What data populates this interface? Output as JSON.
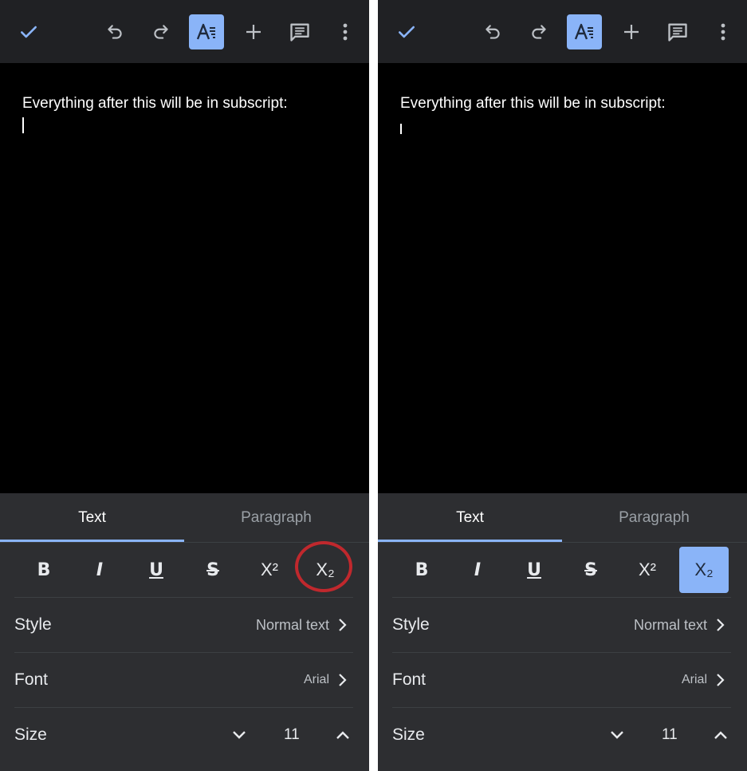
{
  "panels": [
    {
      "id": "before",
      "doc_text": "Everything after this will be in subscript:",
      "tabs": {
        "text": "Text",
        "paragraph": "Paragraph"
      },
      "styles": {
        "superscript": "X²",
        "subscript": "X₂",
        "subscript_active": false
      },
      "rows": {
        "style": {
          "label": "Style",
          "value": "Normal text"
        },
        "font": {
          "label": "Font",
          "value": "Arial"
        },
        "size": {
          "label": "Size",
          "value": "11"
        }
      }
    },
    {
      "id": "after",
      "doc_text": "Everything after this will be in subscript:",
      "tabs": {
        "text": "Text",
        "paragraph": "Paragraph"
      },
      "styles": {
        "superscript": "X²",
        "subscript": "X₂",
        "subscript_active": true
      },
      "rows": {
        "style": {
          "label": "Style",
          "value": "Normal text"
        },
        "font": {
          "label": "Font",
          "value": "Arial"
        },
        "size": {
          "label": "Size",
          "value": "11"
        }
      }
    }
  ],
  "icons": {
    "toolbar": [
      "check-icon",
      "undo-icon",
      "redo-icon",
      "text-format-icon",
      "add-icon",
      "comment-icon",
      "more-vert-icon"
    ],
    "styles": [
      "bold-icon",
      "italic-icon",
      "underline-icon",
      "strikethrough-icon",
      "superscript-icon",
      "subscript-icon"
    ]
  },
  "colors": {
    "accent": "#8ab4f8",
    "toolbar_bg": "#202124",
    "panel_bg": "#2d2e31",
    "annotation_circle": "#c0282d"
  }
}
